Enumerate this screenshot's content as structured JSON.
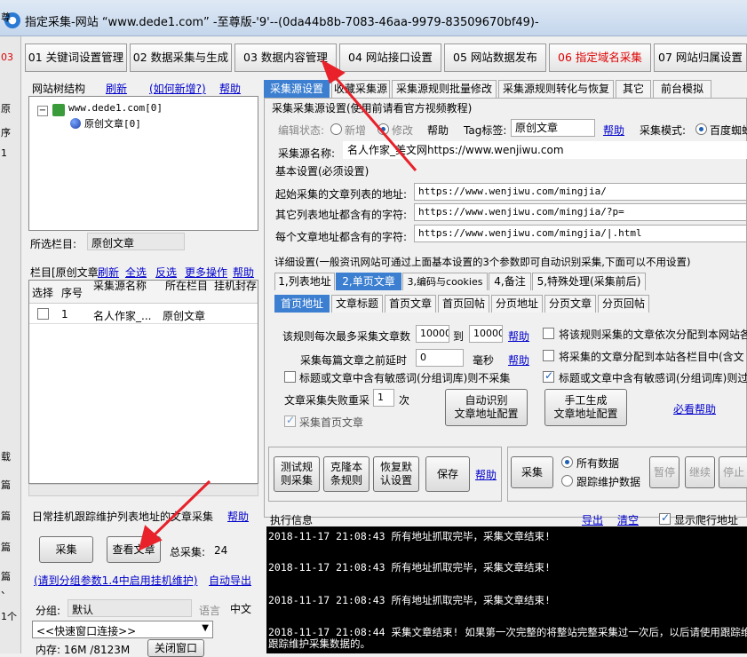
{
  "window": {
    "title": "指定采集-网站 “www.dede1.com” -至尊版-'9'--(0da44b8b-7083-46aa-9979-83509670bf49)-"
  },
  "bg_left": [
    "尊",
    "03",
    "原",
    "序",
    "1",
    "载",
    "篇",
    "篇",
    "篇",
    "篇",
    "、",
    "1个"
  ],
  "main_tabs": [
    {
      "label": "01 关键词设置管理"
    },
    {
      "label": "02 数据采集与生成"
    },
    {
      "label": "03 数据内容管理"
    },
    {
      "label": "04 网站接口设置"
    },
    {
      "label": "05 网站数据发布"
    },
    {
      "label": "06 指定域名采集"
    },
    {
      "label": "07 网站归属设置"
    }
  ],
  "left": {
    "tree_header": "网站树结构",
    "refresh": "刷新",
    "how_add": "(如何新增?)",
    "help": "帮助",
    "tree_root": "www.dede1.com[0]",
    "tree_child": "原创文章[0]",
    "selected_col_label": "所选栏目:",
    "selected_col_value": "原创文章",
    "list_title": "栏目[原创文章",
    "list_refresh": "刷新",
    "select_all": "全选",
    "invert": "反选",
    "more": "更多操作",
    "help2": "帮助",
    "columns": [
      "选择",
      "序号",
      "采集源名称",
      "所在栏目",
      "挂机封存"
    ],
    "rows": [
      {
        "no": "1",
        "name": "名人作家_...",
        "col": "原创文章"
      }
    ],
    "daily_title": "日常挂机跟踪维护列表地址的文章采集",
    "daily_help": "帮助",
    "btn_collect": "采集",
    "btn_view": "查看文章",
    "total_label": "总采集:",
    "total_value": "24",
    "hint_link": "(请到分组参数1.4中启用挂机维护)",
    "auto_export": "自动导出",
    "group_label": "分组:",
    "group_value": "默认",
    "lang_label": "语言",
    "lang_value": "中文",
    "quick_select": "<<快速窗口连接>>",
    "memory": "内存: 16M /8123M",
    "close_btn": "关闭窗口"
  },
  "right": {
    "tabs": [
      "采集源设置",
      "收藏采集源",
      "采集源规则批量修改",
      "采集源规则转化与恢复",
      "其它",
      "前台模拟"
    ],
    "section_title": "采集采集源设置(使用前请看官方视频教程)",
    "edit_status": "编辑状态:",
    "opt_new": "新增",
    "opt_edit": "修改",
    "help": "帮助",
    "tag_label": "Tag标签:",
    "tag_value": "原创文章",
    "tag_help": "帮助",
    "mode_label": "采集模式:",
    "mode_value": "百度蜘蛛",
    "source_name_label": "采集源名称:",
    "source_name_value": "名人作家_美文网https://www.wenjiwu.com",
    "basic_title": "基本设置(必须设置)",
    "start_url_label": "起始采集的文章列表的地址:",
    "start_url": "https://www.wenjiwu.com/mingjia/",
    "other_list_label": "其它列表地址都含有的字符:",
    "other_list": "https://www.wenjiwu.com/mingjia/?p=",
    "article_label": "每个文章地址都含有的字符:",
    "article_value": "https://www.wenjiwu.com/mingjia/|.html",
    "detail_title": "详细设置(一般资讯网站可通过上面基本设置的3个参数即可自动识别采集,下面可以不用设置)",
    "sub_tabs": [
      "1,列表地址",
      "2,单页文章",
      "3,编码与cookies",
      "4,备注",
      "5,特殊处理(采集前后)"
    ],
    "sub_tabs2": [
      "首页地址",
      "文章标题",
      "首页文章",
      "首页回帖",
      "分页地址",
      "分页文章",
      "分页回帖"
    ],
    "max_label": "该规则每次最多采集文章数",
    "max_from": "10000",
    "to": "到",
    "max_to": "10000",
    "help_a": "帮助",
    "delay_label": "采集每篇文章之前延时",
    "delay_value": "0",
    "delay_unit": "毫秒",
    "help_b": "帮助",
    "chk_sensitive": "标题或文章中含有敏感词(分组词库)则不采集",
    "retry_label": "文章采集失败重采",
    "retry_value": "1",
    "retry_unit": "次",
    "chk_first": "采集首页文章",
    "auto_btn_1": "自动识别",
    "auto_btn_2": "文章地址配置",
    "manual_btn_1": "手工生成",
    "manual_btn_2": "文章地址配置",
    "must_help": "必看帮助",
    "chk_r1": "将该规则采集的文章依次分配到本网站各",
    "chk_r2": "将采集的文章分配到本站各栏目中(含文",
    "chk_r3": "标题或文章中含有敏感词(分组词库)则过",
    "btn_test_1": "测试规",
    "btn_test_2": "则采集",
    "btn_clone_1": "克隆本",
    "btn_clone_2": "条规则",
    "btn_restore_1": "恢复默",
    "btn_restore_2": "认设置",
    "btn_save": "保存",
    "save_help": "帮助",
    "btn_collect": "采集",
    "opt_all": "所有数据",
    "opt_track": "跟踪维护数据",
    "btn_pause": "暂停",
    "btn_continue": "继续",
    "btn_stop": "停止",
    "log_title": "执行信息",
    "log_export": "导出",
    "log_clear": "清空",
    "log_show": "显示爬行地址",
    "log_lines": [
      "2018-11-17 21:08:43  所有地址抓取完毕，采集文章结束!",
      "2018-11-17 21:08:43  所有地址抓取完毕，采集文章结束!",
      "2018-11-17 21:08:43  所有地址抓取完毕，采集文章结束!",
      "2018-11-17 21:08:44  采集文章结束! 如果第一次完整的将整站完整采集过一次后，以后请使用跟踪维",
      "跟踪维护采集数据的。"
    ]
  },
  "colors": {
    "accent": "#3c7fd1",
    "red": "#e8212a",
    "link": "#0000cc"
  }
}
